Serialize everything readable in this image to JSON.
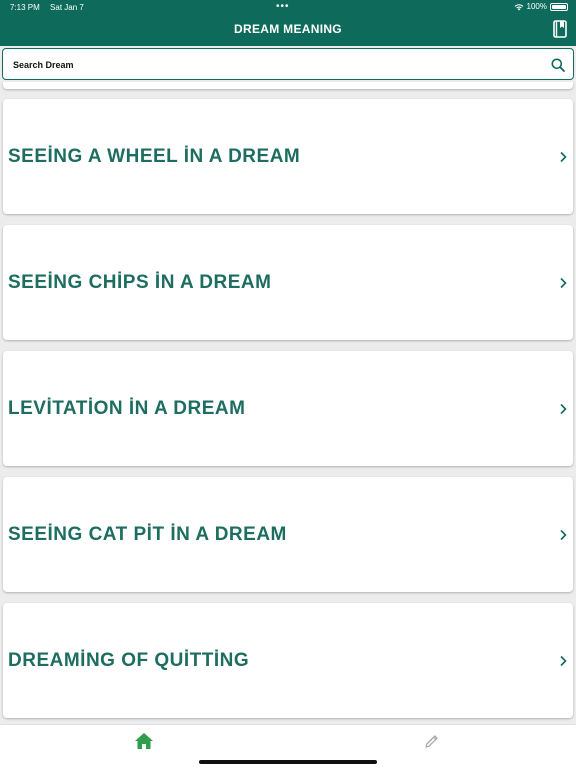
{
  "status_bar": {
    "time": "7:13 PM",
    "date": "Sat Jan 7",
    "battery": "100%",
    "dots": "•••"
  },
  "header": {
    "title": "DREAM MEANING"
  },
  "search": {
    "placeholder": "Search Dream",
    "value": ""
  },
  "items": [
    {
      "label": "SEEİNG A WHEEL İN A DREAM"
    },
    {
      "label": "SEEİNG CHİPS İN A DREAM"
    },
    {
      "label": "LEVİTATİON İN A DREAM"
    },
    {
      "label": "SEEİNG CAT PİT İN A DREAM"
    },
    {
      "label": "DREAMİNG OF QUİTTİNG"
    }
  ],
  "tabs": [
    {
      "icon": "home-icon"
    },
    {
      "icon": "pencil-icon"
    }
  ],
  "colors": {
    "accent": "#0e6b5c",
    "item_text": "#1d6e60",
    "home_tab": "#2e9e4a"
  }
}
